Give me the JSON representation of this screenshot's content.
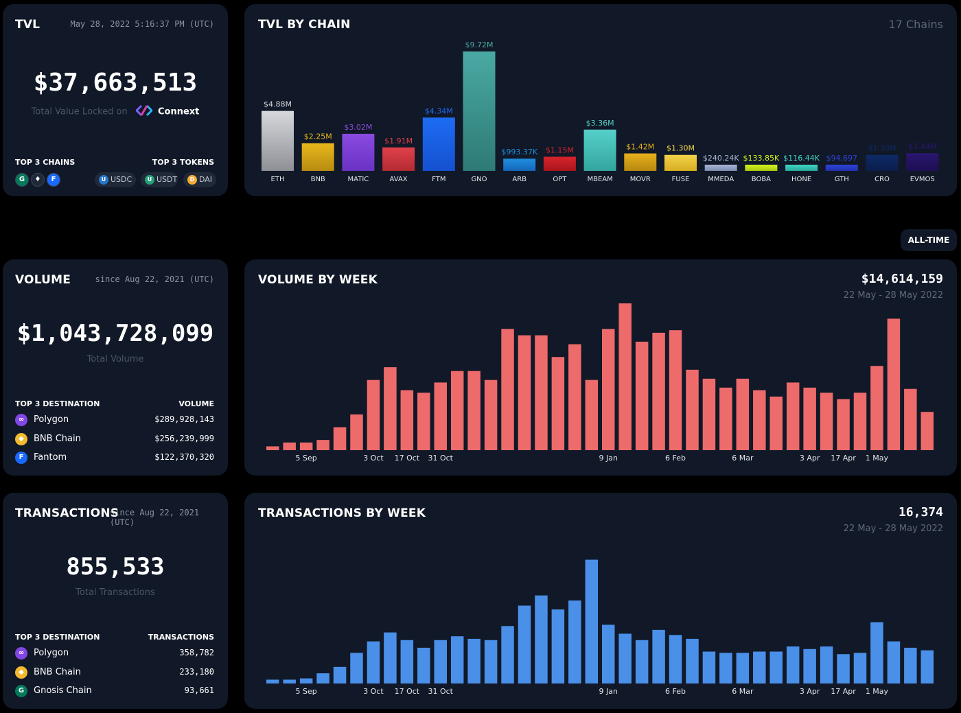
{
  "tvl": {
    "title": "TVL",
    "timestamp": "May 28, 2022 5:16:37 PM (UTC)",
    "value": "$37,663,513",
    "caption": "Total Value Locked on",
    "brand": "Connext",
    "top_chains_label": "TOP 3 CHAINS",
    "top_tokens_label": "TOP 3 TOKENS",
    "top_chains": [
      {
        "icon": "gnosis-icon",
        "glyph": "G",
        "color": "#04795b"
      },
      {
        "icon": "ethereum-icon",
        "glyph": "♦",
        "color": "#ffffff"
      },
      {
        "icon": "fantom-icon",
        "glyph": "F",
        "color": "#1969ff"
      }
    ],
    "top_tokens": [
      {
        "label": "USDC",
        "icon": "usdc-icon",
        "color": "#2775ca"
      },
      {
        "label": "USDT",
        "icon": "usdt-icon",
        "color": "#26a17b"
      },
      {
        "label": "DAI",
        "icon": "dai-icon",
        "color": "#f5ac37"
      }
    ]
  },
  "tvl_by_chain": {
    "title": "TVL BY CHAIN",
    "count": "17 Chains"
  },
  "volume": {
    "title": "VOLUME",
    "since": "since Aug 22, 2021 (UTC)",
    "value": "$1,043,728,099",
    "caption": "Total Volume",
    "dest_header": "TOP 3 DESTINATION",
    "val_header": "VOLUME",
    "rows": [
      {
        "name": "Polygon",
        "value": "$289,928,143",
        "icon": "polygon-icon",
        "glyph": "∞",
        "color": "#8247e5"
      },
      {
        "name": "BNB Chain",
        "value": "$256,239,999",
        "icon": "bnb-icon",
        "glyph": "◆",
        "color": "#f3ba2f"
      },
      {
        "name": "Fantom",
        "value": "$122,370,320",
        "icon": "fantom-icon",
        "glyph": "F",
        "color": "#1969ff"
      }
    ]
  },
  "volume_by_week": {
    "title": "VOLUME BY WEEK",
    "value": "$14,614,159",
    "range": "22 May - 28 May 2022"
  },
  "transactions": {
    "title": "TRANSACTIONS",
    "since": "since Aug 22, 2021 (UTC)",
    "value": "855,533",
    "caption": "Total Transactions",
    "dest_header": "TOP 3 DESTINATION",
    "val_header": "TRANSACTIONS",
    "rows": [
      {
        "name": "Polygon",
        "value": "358,782",
        "icon": "polygon-icon",
        "glyph": "∞",
        "color": "#8247e5"
      },
      {
        "name": "BNB Chain",
        "value": "233,180",
        "icon": "bnb-icon",
        "glyph": "◆",
        "color": "#f3ba2f"
      },
      {
        "name": "Gnosis Chain",
        "value": "93,661",
        "icon": "gnosis-icon",
        "glyph": "G",
        "color": "#04795b"
      }
    ]
  },
  "transactions_by_week": {
    "title": "TRANSACTIONS BY WEEK",
    "value": "16,374",
    "range": "22 May - 28 May 2022"
  },
  "alltime_label": "ALL-TIME",
  "chart_data": [
    {
      "type": "bar",
      "title": "TVL BY CHAIN",
      "categories": [
        "ETH",
        "BNB",
        "MATIC",
        "AVAX",
        "FTM",
        "GNO",
        "ARB",
        "OPT",
        "MBEAM",
        "MOVR",
        "FUSE",
        "MMEDA",
        "BOBA",
        "HONE",
        "GTH",
        "CRO",
        "EVMOS"
      ],
      "values": [
        4.88,
        2.25,
        3.02,
        1.91,
        4.34,
        9.72,
        0.99337,
        1.15,
        3.36,
        1.42,
        1.3,
        0.24024,
        0.13385,
        0.11644,
        0.094697,
        1.3,
        1.44
      ],
      "value_labels": [
        "$4.88M",
        "$2.25M",
        "$3.02M",
        "$1.91M",
        "$4.34M",
        "$9.72M",
        "$993.37K",
        "$1.15M",
        "$3.36M",
        "$1.42M",
        "$1.30M",
        "$240.24K",
        "$133.85K",
        "$116.44K",
        "$94,697",
        "$1.30M",
        "$1.44M"
      ],
      "colors": [
        [
          "#d6d8dc",
          "#8e9096"
        ],
        [
          "#e8b71c",
          "#b78c10"
        ],
        [
          "#8a4be0",
          "#6a32c4"
        ],
        [
          "#e0414a",
          "#b42a32"
        ],
        [
          "#1d6cf2",
          "#1551d0"
        ],
        [
          "#4aa9a3",
          "#2e7a76"
        ],
        [
          "#1f8fe0",
          "#1565b8"
        ],
        [
          "#d9242c",
          "#a8161c"
        ],
        [
          "#56d0c9",
          "#33a59f"
        ],
        [
          "#e8b01c",
          "#b78810"
        ],
        [
          "#f3d24a",
          "#d6ae20"
        ],
        [
          "#a9b6d6",
          "#7d8bb0"
        ],
        [
          "#d4f51f",
          "#a9c810"
        ],
        [
          "#3fd6c6",
          "#28a89b"
        ],
        [
          "#2e42d6",
          "#2232b0"
        ],
        [
          "#0e2a66",
          "#0a1e4c"
        ],
        [
          "#2a1670",
          "#1d0f52"
        ]
      ],
      "ylim": [
        0,
        9.72
      ]
    },
    {
      "type": "bar",
      "title": "VOLUME BY WEEK",
      "values": [
        3,
        6,
        6,
        8,
        18,
        28,
        55,
        65,
        47,
        45,
        53,
        62,
        62,
        55,
        95,
        90,
        90,
        73,
        83,
        55,
        95,
        115,
        85,
        92,
        94,
        63,
        56,
        49,
        56,
        47,
        42,
        53,
        49,
        45,
        40,
        45,
        66,
        103,
        48,
        30
      ],
      "tick_labels": [
        {
          "i": 2,
          "label": "5 Sep"
        },
        {
          "i": 6,
          "label": "3 Oct"
        },
        {
          "i": 8,
          "label": "17 Oct"
        },
        {
          "i": 10,
          "label": "31 Oct"
        },
        {
          "i": 20,
          "label": "9 Jan"
        },
        {
          "i": 24,
          "label": "6 Feb"
        },
        {
          "i": 28,
          "label": "6 Mar"
        },
        {
          "i": 32,
          "label": "3 Apr"
        },
        {
          "i": 34,
          "label": "17 Apr"
        },
        {
          "i": 36,
          "label": "1 May"
        }
      ],
      "color": "#ee6b6b"
    },
    {
      "type": "bar",
      "title": "TRANSACTIONS BY WEEK",
      "values": [
        3,
        3,
        4,
        8,
        13,
        24,
        33,
        40,
        34,
        28,
        34,
        37,
        35,
        34,
        45,
        61,
        69,
        58,
        65,
        97,
        46,
        39,
        34,
        42,
        38,
        35,
        25,
        24,
        24,
        25,
        25,
        29,
        27,
        29,
        23,
        24,
        48,
        33,
        28,
        26
      ],
      "tick_labels": [
        {
          "i": 2,
          "label": "5 Sep"
        },
        {
          "i": 6,
          "label": "3 Oct"
        },
        {
          "i": 8,
          "label": "17 Oct"
        },
        {
          "i": 10,
          "label": "31 Oct"
        },
        {
          "i": 20,
          "label": "9 Jan"
        },
        {
          "i": 24,
          "label": "6 Feb"
        },
        {
          "i": 28,
          "label": "6 Mar"
        },
        {
          "i": 32,
          "label": "3 Apr"
        },
        {
          "i": 34,
          "label": "17 Apr"
        },
        {
          "i": 36,
          "label": "1 May"
        }
      ],
      "color": "#4a90e8"
    }
  ]
}
